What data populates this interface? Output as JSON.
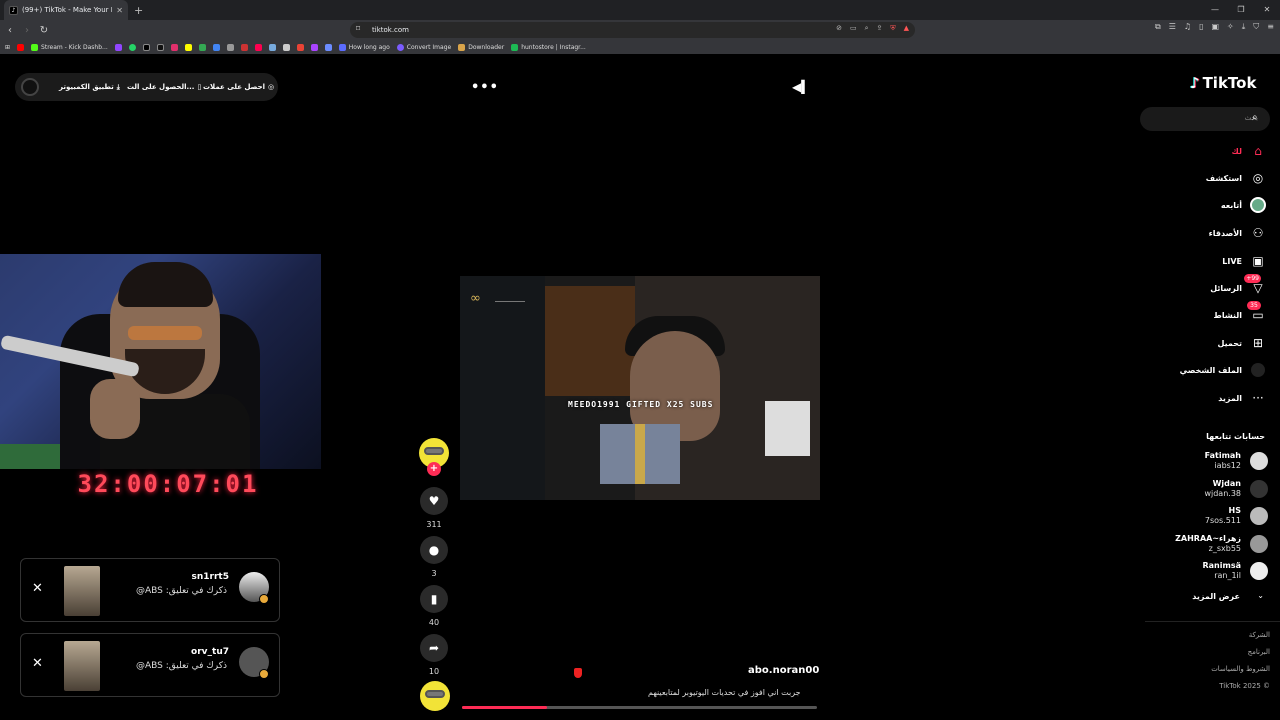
{
  "browser": {
    "tab_title": "(99+) TikTok - Make Your Day",
    "url": "tiktok.com",
    "bookmarks": [
      {
        "label": "Stream - Kick Dashb...",
        "color": "#53fc18"
      },
      {
        "label": "How long ago",
        "color": "#5b6cff"
      },
      {
        "label": "Convert Image",
        "color": "#7b5cff"
      },
      {
        "label": "Downloader",
        "color": "#d9a44a"
      },
      {
        "label": "huntostore | Instagr...",
        "color": "#1db954"
      }
    ]
  },
  "topbar": {
    "coins_label": "احصل على عملات",
    "get_label": "الحصول على الت...",
    "desktop_app_label": "تطبيق الكمبيوتر"
  },
  "overlay": {
    "timer": "32:00:07:01"
  },
  "notifications": [
    {
      "user": "sn1rrt5",
      "message": "ذكرك في تعليق: ABS@"
    },
    {
      "user": "orv_tu7",
      "message": "ذكرك في تعليق: ABS@"
    }
  ],
  "actions": {
    "likes": "311",
    "comments": "3",
    "saves": "40",
    "shares": "10"
  },
  "video": {
    "caption_overlay": "MEEDO1991 GIFTED X25 SUBS",
    "author": "abo.noran00",
    "description": "جربت اني افوز في تحديات اليوتيوبر لمتابعينهم",
    "progress": 0.24
  },
  "sidebar": {
    "logo": "TikTok",
    "search_placeholder": "بحث",
    "nav": [
      {
        "label": "لك",
        "icon": "home-icon"
      },
      {
        "label": "استكشف",
        "icon": "compass-icon"
      },
      {
        "label": "أتابعه",
        "icon": "following-avatar-icon"
      },
      {
        "label": "الأصدقاء",
        "icon": "friends-icon"
      },
      {
        "label": "LIVE",
        "icon": "live-icon"
      },
      {
        "label": "الرسائل",
        "icon": "messages-icon",
        "badge": "+99"
      },
      {
        "label": "النشاط",
        "icon": "activity-icon",
        "badge": "35"
      },
      {
        "label": "تحميل",
        "icon": "upload-icon"
      },
      {
        "label": "الملف الشخصي",
        "icon": "profile-icon"
      },
      {
        "label": "المزيد",
        "icon": "more-icon"
      }
    ],
    "following_title": "حسابات تتابعها",
    "following": [
      {
        "name": "Fatimah",
        "handle": "iabs12"
      },
      {
        "name": "Wjdan",
        "handle": "wjdan.38"
      },
      {
        "name": "HS",
        "handle": "7sos.511"
      },
      {
        "name": "ZAHRAA~زهراء",
        "handle": "z_sxb55"
      },
      {
        "name": "Ranimsä",
        "handle": "ran_1il"
      }
    ],
    "see_more": "عرض المزيد",
    "footer": [
      "الشركة",
      "البرنامج",
      "الشروط والسياسات",
      "TikTok 2025 ©"
    ]
  }
}
